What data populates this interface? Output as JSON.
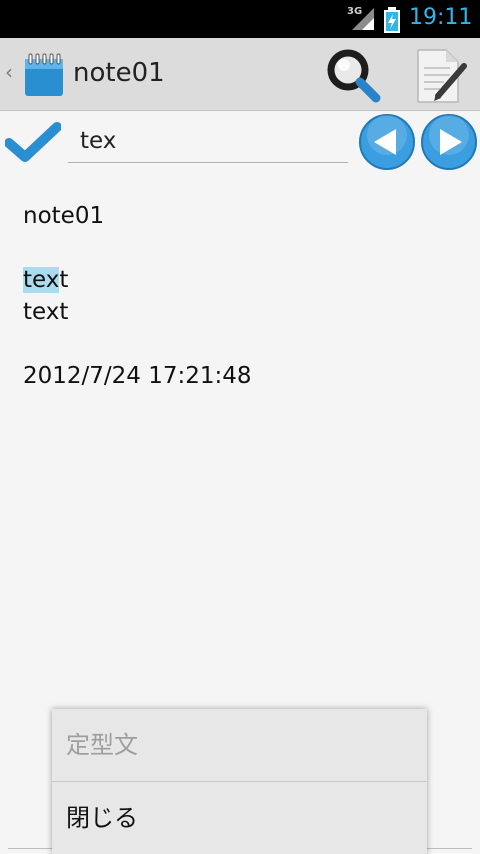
{
  "status_bar": {
    "network": "3G",
    "time": "19:11",
    "accent_color": "#33b5e5"
  },
  "action_bar": {
    "title": "note01",
    "icons": [
      "up-caret-icon",
      "notepad-icon",
      "search-icon",
      "edit-note-icon"
    ]
  },
  "find_bar": {
    "query": "tex",
    "icons": [
      "checkmark-icon",
      "previous-arrow-icon",
      "next-arrow-icon"
    ]
  },
  "note": {
    "line1": "note01",
    "line2": "",
    "line3_highlight": "tex",
    "line3_rest": "t",
    "line4": "text",
    "line5": "",
    "line6": "2012/7/24 17:21:48",
    "highlight_color": "#a9dcef"
  },
  "popup_menu": {
    "items": [
      {
        "label": "定型文",
        "enabled": false
      },
      {
        "label": "閉じる",
        "enabled": true
      }
    ]
  }
}
